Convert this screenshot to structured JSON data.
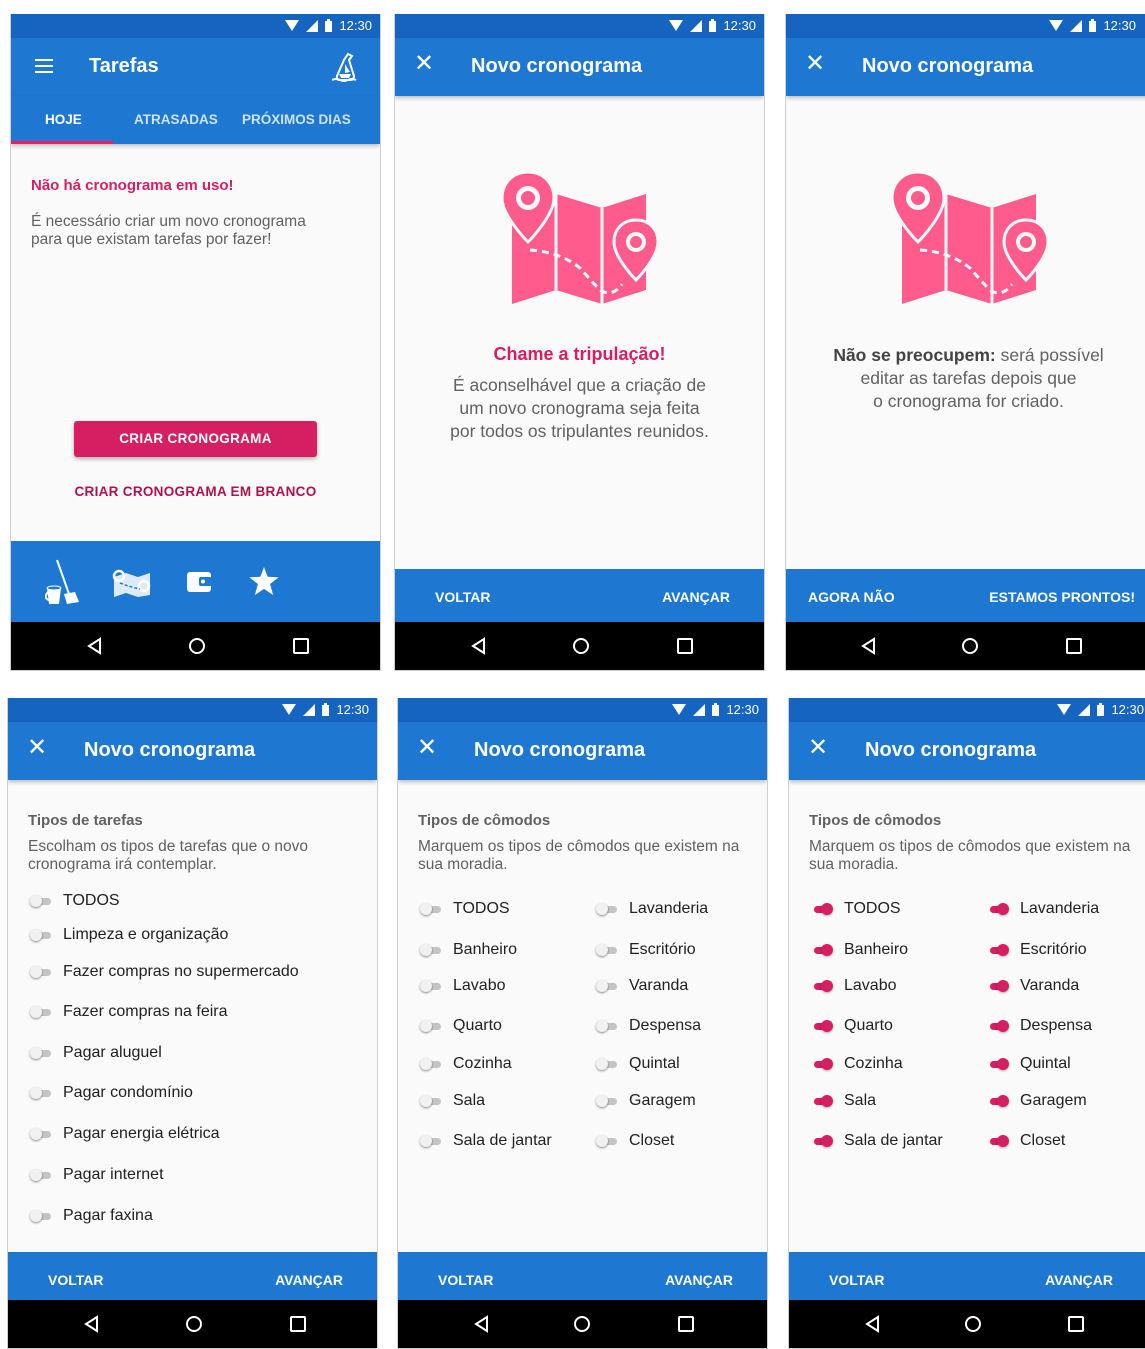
{
  "status": {
    "time": "12:30"
  },
  "colors": {
    "primary": "#1e78d2",
    "status_bar": "#1565c0",
    "accent": "#e91e63",
    "pink_text": "#d61f63",
    "map_icon": "#ff5c8d"
  },
  "screen1": {
    "title": "Tarefas",
    "tabs": [
      {
        "label": "HOJE"
      },
      {
        "label": "ATRASADAS"
      },
      {
        "label": "PRÓXIMOS DIAS"
      }
    ],
    "alert_title": "Não há cronograma em uso!",
    "alert_text": "É necessário criar um novo cronograma para que existam tarefas por fazer!",
    "primary_button": "CRIAR CRONOGRAMA",
    "secondary_button": "CRIAR CRONOGRAMA EM BRANCO",
    "bottom_icons": [
      "broom-bucket-icon",
      "map-icon",
      "wallet-icon",
      "star-icon"
    ]
  },
  "screen2": {
    "title": "Novo cronograma",
    "heading": "Chame a tripulação!",
    "line1": "É aconselhável que a criação de",
    "line2": "um novo cronograma seja feita",
    "line3": "por todos os tripulantes reunidos.",
    "back": "VOLTAR",
    "next": "AVANÇAR"
  },
  "screen3": {
    "title": "Novo cronograma",
    "bold": "Não se preocupem:",
    "line1_rest": " será possível",
    "line2": "editar as tarefas depois que",
    "line3": "o cronograma for criado.",
    "back": "AGORA NÃO",
    "next": "ESTAMOS PRONTOS!"
  },
  "screen4": {
    "title": "Novo cronograma",
    "heading": "Tipos de tarefas",
    "description": "Escolham os tipos de tarefas que o novo cronograma irá contemplar.",
    "items": [
      {
        "label": "TODOS",
        "on": false
      },
      {
        "label": "Limpeza e organização",
        "on": false
      },
      {
        "label": "Fazer compras no supermercado",
        "on": false
      },
      {
        "label": "Fazer compras na feira",
        "on": false
      },
      {
        "label": "Pagar aluguel",
        "on": false
      },
      {
        "label": "Pagar condomínio",
        "on": false
      },
      {
        "label": "Pagar energia elétrica",
        "on": false
      },
      {
        "label": "Pagar internet",
        "on": false
      },
      {
        "label": "Pagar faxina",
        "on": false
      }
    ],
    "back": "VOLTAR",
    "next": "AVANÇAR"
  },
  "screen5": {
    "title": "Novo cronograma",
    "heading": "Tipos de cômodos",
    "description": "Marquem os tipos de cômodos que existem na sua moradia.",
    "left": [
      {
        "label": "TODOS",
        "on": false
      },
      {
        "label": "Banheiro",
        "on": false
      },
      {
        "label": "Lavabo",
        "on": false
      },
      {
        "label": "Quarto",
        "on": false
      },
      {
        "label": "Cozinha",
        "on": false
      },
      {
        "label": "Sala",
        "on": false
      },
      {
        "label": "Sala de jantar",
        "on": false
      }
    ],
    "right": [
      {
        "label": "Lavanderia",
        "on": false
      },
      {
        "label": "Escritório",
        "on": false
      },
      {
        "label": "Varanda",
        "on": false
      },
      {
        "label": "Despensa",
        "on": false
      },
      {
        "label": "Quintal",
        "on": false
      },
      {
        "label": "Garagem",
        "on": false
      },
      {
        "label": "Closet",
        "on": false
      }
    ],
    "back": "VOLTAR",
    "next": "AVANÇAR"
  },
  "screen6": {
    "title": "Novo cronograma",
    "heading": "Tipos de cômodos",
    "description": "Marquem os tipos de cômodos que existem na sua moradia.",
    "left": [
      {
        "label": "TODOS",
        "on": true
      },
      {
        "label": "Banheiro",
        "on": true
      },
      {
        "label": "Lavabo",
        "on": true
      },
      {
        "label": "Quarto",
        "on": true
      },
      {
        "label": "Cozinha",
        "on": true
      },
      {
        "label": "Sala",
        "on": true
      },
      {
        "label": "Sala de jantar",
        "on": true
      }
    ],
    "right": [
      {
        "label": "Lavanderia",
        "on": true
      },
      {
        "label": "Escritório",
        "on": true
      },
      {
        "label": "Varanda",
        "on": true
      },
      {
        "label": "Despensa",
        "on": true
      },
      {
        "label": "Quintal",
        "on": true
      },
      {
        "label": "Garagem",
        "on": true
      },
      {
        "label": "Closet",
        "on": true
      }
    ],
    "back": "VOLTAR",
    "next": "AVANÇAR"
  }
}
